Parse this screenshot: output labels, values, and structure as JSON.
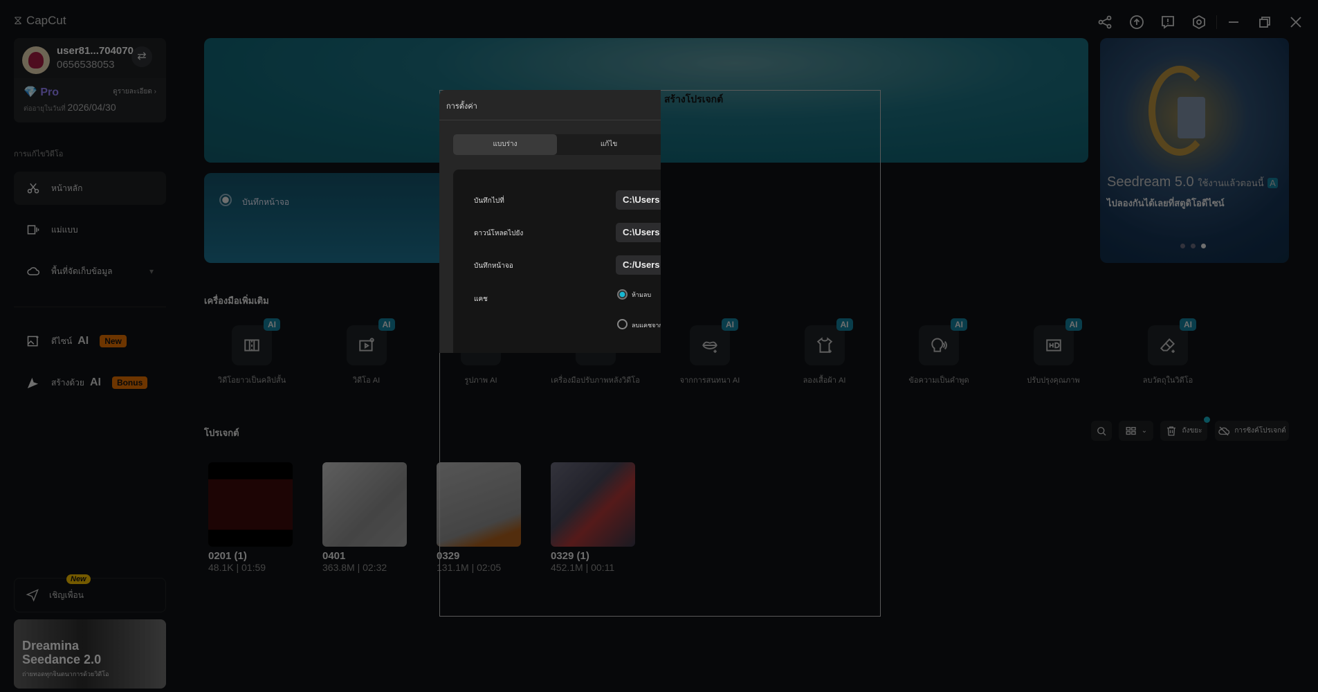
{
  "app": {
    "name": "CapCut"
  },
  "titlebar": {
    "icons": [
      "share-icon",
      "upload-icon",
      "feedback-icon",
      "settings-icon",
      "minimize-icon",
      "restore-icon",
      "close-icon"
    ]
  },
  "account": {
    "username": "user81...704070",
    "phone": "0656538053",
    "plan": "Pro",
    "details_link": "ดูรายละเอียด",
    "expiry_label": "ต่ออายุในวันที่",
    "expiry_date": "2026/04/30"
  },
  "sidebar": {
    "section_label": "การแก้ไขวิดีโอ",
    "items": [
      {
        "label": "หน้าหลัก",
        "icon": "scissors-icon"
      },
      {
        "label": "แม่แบบ",
        "icon": "template-icon"
      },
      {
        "label": "พื้นที่จัดเก็บข้อมูล",
        "icon": "cloud-icon"
      }
    ],
    "ai_items": [
      {
        "label": "ดีไซน์",
        "ai": "AI",
        "badge": "New"
      },
      {
        "label": "สร้างด้วย",
        "ai": "AI",
        "badge": "Bonus"
      }
    ],
    "invite": {
      "label": "เชิญเพื่อน",
      "badge": "New"
    },
    "promo": {
      "title": "Dreamina Seedance 2.0",
      "subtitle": "ถ่ายทอดทุกจินตนาการด้วยวิดีโอ"
    }
  },
  "main": {
    "banner_text": "สร้างโปรเจกต์",
    "record_label": "บันทึกหน้าจอ",
    "tools_heading": "เครื่องมือเพิ่มเติม",
    "tools": [
      {
        "label": "วิดีโอยาวเป็นคลิปสั้น",
        "icon": "split-video-icon",
        "ai": "AI"
      },
      {
        "label": "วิดีโอ AI",
        "icon": "video-ai-icon",
        "ai": "AI"
      },
      {
        "label": "รูปภาพ AI",
        "icon": "image-ai-icon",
        "ai": "AI"
      },
      {
        "label": "เครื่องมือปรับภาพหลังวิดีโอ",
        "icon": "video-tool-icon",
        "ai": "AI"
      },
      {
        "label": "จากการสนทนา AI",
        "icon": "lips-icon",
        "ai": "AI"
      },
      {
        "label": "ลองเสื้อผ้า AI",
        "icon": "shirt-icon",
        "ai": "AI"
      },
      {
        "label": "ข้อความเป็นคำพูด",
        "icon": "speech-icon",
        "ai": "AI"
      },
      {
        "label": "ปรับปรุงคุณภาพ",
        "icon": "hd-icon",
        "ai": "AI"
      },
      {
        "label": "ลบวัตถุในวิดีโอ",
        "icon": "eraser-icon",
        "ai": "AI"
      }
    ],
    "projects_heading": "โปรเจกต์",
    "project_toolbar": {
      "trash_label": "ถังขยะ",
      "sync_label": "การซิงค์โปรเจกต์"
    },
    "projects": [
      {
        "name": "0201 (1)",
        "meta": "48.1K | 01:59"
      },
      {
        "name": "0401",
        "meta": "363.8M | 02:32"
      },
      {
        "name": "0329",
        "meta": "131.1M | 02:05"
      },
      {
        "name": "0329 (1)",
        "meta": "452.1M | 00:11"
      }
    ]
  },
  "right_promo": {
    "title": "Seedream 5.0",
    "title_suffix": "ใช้งานแล้วตอนนี้",
    "badge": "A",
    "subtitle": "ไปลองกันได้เลยที่สตูดิโอดีไซน์",
    "slide": 3,
    "slides": 3
  },
  "dialog": {
    "title": "การตั้งค่า",
    "tabs": [
      "แบบร่าง",
      "แก้ไข"
    ],
    "active_tab": 0,
    "rows": [
      {
        "label": "บันทึกไปที่",
        "value": "C:\\Users"
      },
      {
        "label": "ดาวน์โหลดไปยัง",
        "value": "C:\\Users"
      },
      {
        "label": "บันทึกหน้าจอ",
        "value": "C:/Users"
      }
    ],
    "cache": {
      "label": "แคช",
      "options": [
        "ห้ามลบ",
        "ลบแคชจาก"
      ],
      "selected": 0
    }
  },
  "colors": {
    "accent": "#17b8d3",
    "pro": "#8f7cf0",
    "badge_orange": "#d96a00",
    "ai_badge": "#127a96"
  }
}
